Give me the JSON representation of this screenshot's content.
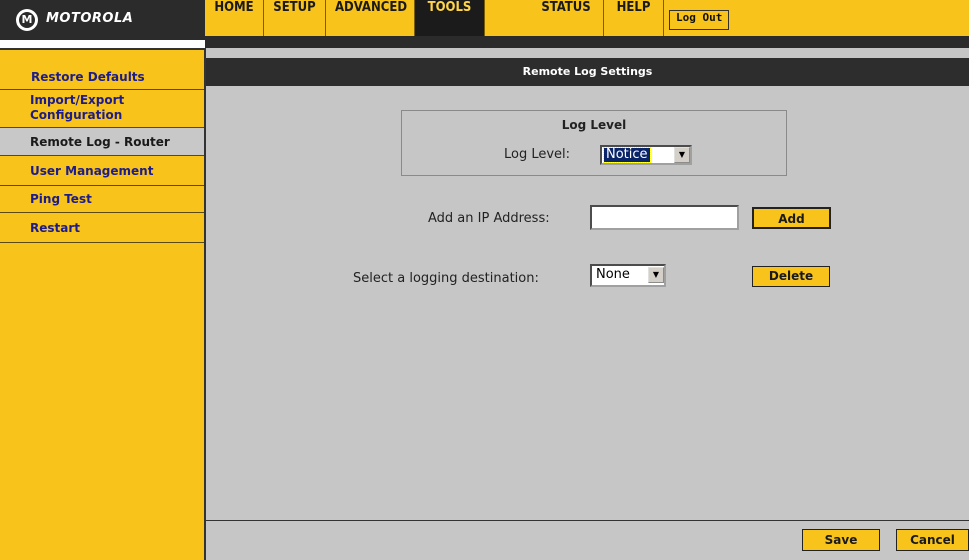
{
  "brand": {
    "logo_text": "MOTOROLA",
    "logo_icon": "motorola-batwing-icon",
    "accent_color": "#f8c31a"
  },
  "topnav": {
    "items": [
      {
        "label": "HOME"
      },
      {
        "label": "SETUP"
      },
      {
        "label": "ADVANCED"
      },
      {
        "label": "TOOLS",
        "active": true
      },
      {
        "label": "STATUS"
      },
      {
        "label": "HELP"
      }
    ],
    "logout_label": "Log Out"
  },
  "sidebar": {
    "items": [
      {
        "label": "Restore Defaults"
      },
      {
        "label": "Import/Export\nConfiguration"
      },
      {
        "label": "Remote Log - Router",
        "current": true
      },
      {
        "label": "User Management"
      },
      {
        "label": "Ping Test"
      },
      {
        "label": "Restart"
      }
    ]
  },
  "main": {
    "section_title": "Remote Log Settings",
    "log_level": {
      "heading": "Log Level",
      "label": "Log Level:",
      "selected": "Notice"
    },
    "add_ip": {
      "label": "Add an IP Address:",
      "value": "",
      "button_label": "Add"
    },
    "destination": {
      "label": "Select a logging destination:",
      "selected": "None",
      "delete_label": "Delete"
    },
    "footer": {
      "save_label": "Save",
      "cancel_label": "Cancel"
    }
  }
}
